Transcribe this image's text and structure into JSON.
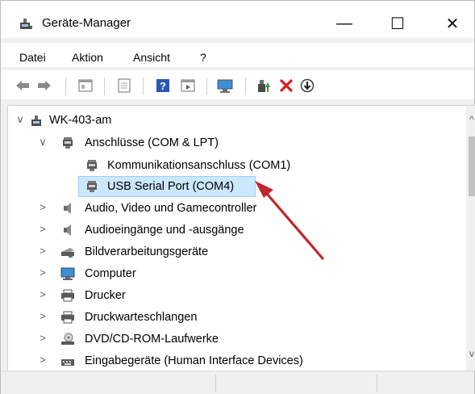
{
  "window": {
    "title": "Geräte-Manager",
    "controls": {
      "minimize": "—",
      "maximize": "☐",
      "close": "✕"
    }
  },
  "menu": [
    "Datei",
    "Aktion",
    "Ansicht",
    "?"
  ],
  "toolbar_icons": [
    "back-arrow-icon",
    "forward-arrow-icon",
    "properties-icon",
    "refresh-icon",
    "help-icon",
    "view-icon",
    "scan-hardware-icon",
    "update-driver-icon",
    "uninstall-icon",
    "disable-icon"
  ],
  "tree": {
    "root": {
      "label": "WK-403-am",
      "toggle": "∨"
    },
    "items": [
      {
        "label": "Anschlüsse (COM & LPT)",
        "toggle": "∨",
        "level": 1
      },
      {
        "label": "Kommunikationsanschluss (COM1)",
        "toggle": "",
        "level": 2
      },
      {
        "label": "USB Serial Port (COM4)",
        "toggle": "",
        "level": 2,
        "selected": true
      },
      {
        "label": "Audio, Video und Gamecontroller",
        "toggle": ">",
        "level": 1
      },
      {
        "label": "Audioeingänge und -ausgänge",
        "toggle": ">",
        "level": 1
      },
      {
        "label": "Bildverarbeitungsgeräte",
        "toggle": ">",
        "level": 1
      },
      {
        "label": "Computer",
        "toggle": ">",
        "level": 1
      },
      {
        "label": "Drucker",
        "toggle": ">",
        "level": 1
      },
      {
        "label": "Druckwarteschlangen",
        "toggle": ">",
        "level": 1
      },
      {
        "label": "DVD/CD-ROM-Laufwerke",
        "toggle": ">",
        "level": 1
      },
      {
        "label": "Eingabegeräte (Human Interface Devices)",
        "toggle": ">",
        "level": 1
      }
    ]
  },
  "scrollbar": {
    "up": "^",
    "down": "v"
  },
  "colors": {
    "selection": "#cce8ff",
    "annotation_arrow": "#c0272d"
  }
}
